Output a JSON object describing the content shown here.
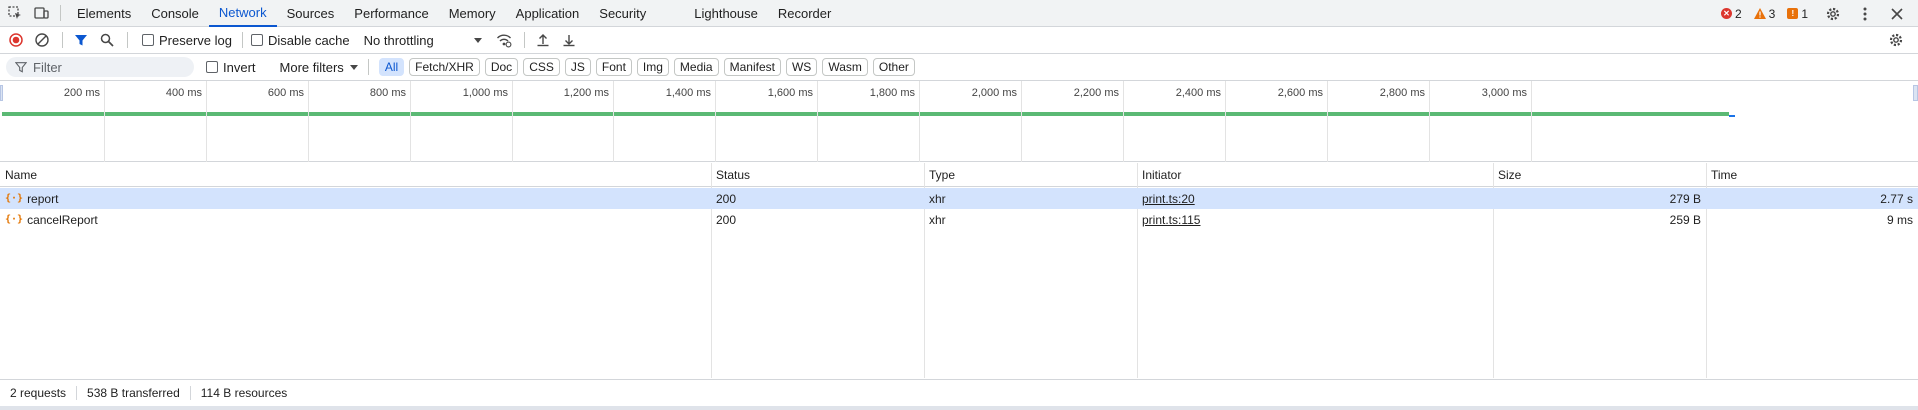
{
  "tabs": [
    "Elements",
    "Console",
    "Network",
    "Sources",
    "Performance",
    "Memory",
    "Application",
    "Security",
    "Lighthouse",
    "Recorder"
  ],
  "active_tab": "Network",
  "issues": {
    "errors": "2",
    "warnings": "3",
    "info": "1"
  },
  "toolbar": {
    "preserve_log": "Preserve log",
    "disable_cache": "Disable cache",
    "throttling": "No throttling"
  },
  "filterbar": {
    "placeholder": "Filter",
    "invert": "Invert",
    "more_filters": "More filters",
    "types": [
      "All",
      "Fetch/XHR",
      "Doc",
      "CSS",
      "JS",
      "Font",
      "Img",
      "Media",
      "Manifest",
      "WS",
      "Wasm",
      "Other"
    ],
    "active_type": "All"
  },
  "timeline": {
    "ticks": [
      "200 ms",
      "400 ms",
      "600 ms",
      "800 ms",
      "1,000 ms",
      "1,200 ms",
      "1,400 ms",
      "1,600 ms",
      "1,800 ms",
      "2,000 ms",
      "2,200 ms",
      "2,400 ms",
      "2,600 ms",
      "2,800 ms",
      "3,000 ms"
    ]
  },
  "table": {
    "columns": [
      "Name",
      "Status",
      "Type",
      "Initiator",
      "Size",
      "Time"
    ],
    "rows": [
      {
        "name": "report",
        "status": "200",
        "type": "xhr",
        "initiator": "print.ts:20",
        "size": "279 B",
        "time": "2.77 s",
        "selected": true
      },
      {
        "name": "cancelReport",
        "status": "200",
        "type": "xhr",
        "initiator": "print.ts:115",
        "size": "259 B",
        "time": "9 ms",
        "selected": false
      }
    ]
  },
  "status": {
    "requests": "2 requests",
    "transferred": "538 B transferred",
    "resources": "114 B resources"
  },
  "icons": [
    "inspect-element-icon",
    "device-toolbar-icon",
    "record-stop-icon",
    "clear-icon",
    "filter-icon",
    "search-icon",
    "network-conditions-icon",
    "import-har-icon",
    "export-har-icon",
    "settings-icon",
    "more-options-icon",
    "close-icon",
    "network-settings-icon"
  ],
  "colors": {
    "accent": "#0b57d0",
    "record": "#dc362e",
    "selected_row": "#d3e3fd",
    "timeline_bar": "#5bb974"
  }
}
